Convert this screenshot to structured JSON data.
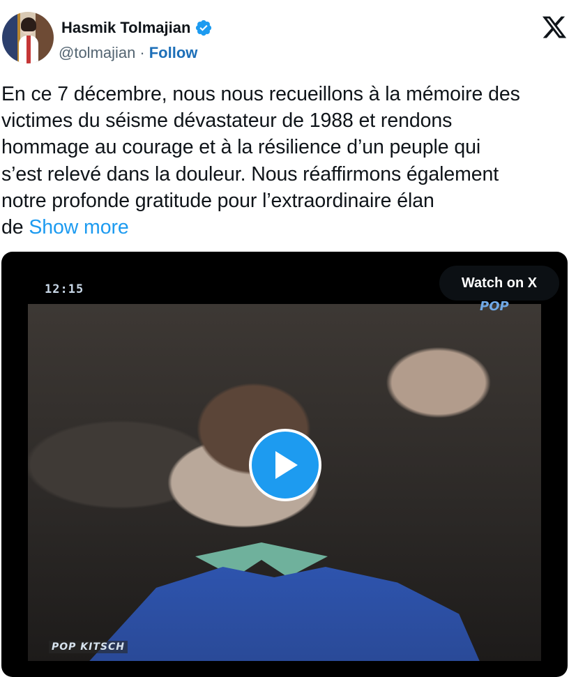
{
  "author": {
    "name": "Hasmik Tolmajian",
    "handle": "@tolmajian",
    "separator": "·",
    "follow_label": "Follow",
    "verified": true
  },
  "tweet": {
    "lines": [
      "En ce 7 décembre, nous nous recueillons à la mémoire des",
      "victimes du séisme dévastateur de 1988 et rendons",
      "hommage au courage et à la résilience d’un peuple qui",
      "s’est relevé dans la douleur. Nous réaffirmons également",
      "notre profonde gratitude pour l’extraordinaire élan"
    ],
    "last_line_prefix": "de",
    "show_more": "Show more"
  },
  "video": {
    "timestamp": "12:15",
    "channel_logo": "POP",
    "bottom_logo": "POP KITSCH",
    "watch_label": "Watch on X"
  },
  "icons": {
    "verified": "verified-badge-icon",
    "brand": "x-logo-icon",
    "play": "play-icon"
  },
  "colors": {
    "accent": "#1d9bf0",
    "follow": "#1d6fb8",
    "text": "#0f1419",
    "secondary": "#536471"
  }
}
